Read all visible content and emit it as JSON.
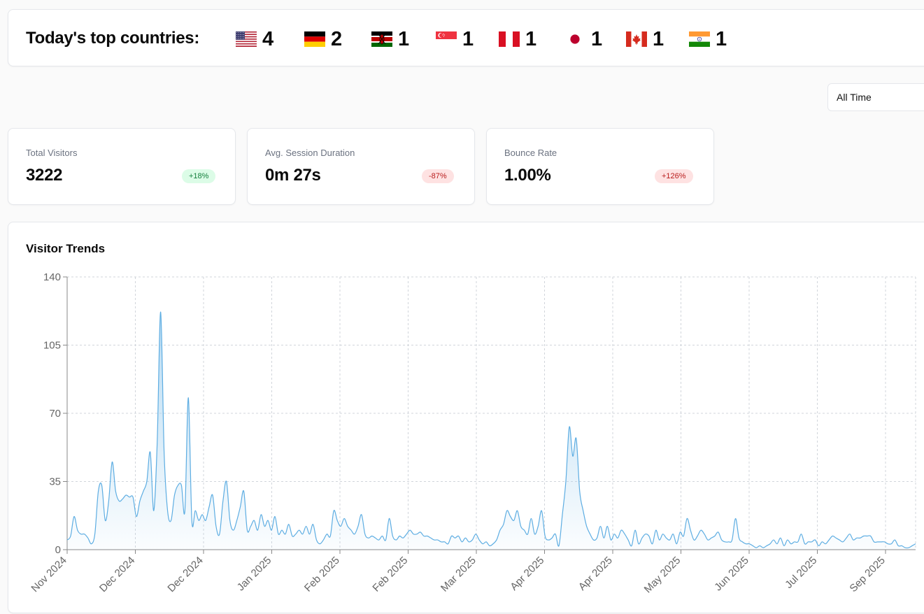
{
  "top_countries": {
    "title": "Today's top countries:",
    "items": [
      {
        "flag": "us-flag-icon",
        "count": "4"
      },
      {
        "flag": "germany-flag-icon",
        "count": "2"
      },
      {
        "flag": "kenya-flag-icon",
        "count": "1"
      },
      {
        "flag": "singapore-flag-icon",
        "count": "1"
      },
      {
        "flag": "peru-flag-icon",
        "count": "1"
      },
      {
        "flag": "japan-flag-icon",
        "count": "1"
      },
      {
        "flag": "canada-flag-icon",
        "count": "1"
      },
      {
        "flag": "india-flag-icon",
        "count": "1"
      }
    ]
  },
  "range_select": {
    "value": "All Time"
  },
  "stats": [
    {
      "label": "Total Visitors",
      "value": "3222",
      "change": "+18%",
      "trend": "up"
    },
    {
      "label": "Avg. Session Duration",
      "value": "0m 27s",
      "change": "-87%",
      "trend": "down"
    },
    {
      "label": "Bounce Rate",
      "value": "1.00%",
      "change": "+126%",
      "trend": "down"
    }
  ],
  "chart_card": {
    "title": "Visitor Trends"
  },
  "colors": {
    "line": "#5dade2",
    "fill": "#aed6f1",
    "grid": "#d1d5db",
    "up": "#15803d",
    "down": "#b91c1c"
  },
  "chart_data": {
    "type": "area",
    "title": "Visitor Trends",
    "ylim": [
      0,
      140
    ],
    "yticks": [
      0,
      35,
      70,
      105,
      140
    ],
    "grid": true,
    "xtick_labels": [
      "Nov 2024",
      "Dec 2024",
      "Dec 2024",
      "Jan 2025",
      "Feb 2025",
      "Feb 2025",
      "Mar 2025",
      "Apr 2025",
      "Apr 2025",
      "May 2025",
      "Jun 2025",
      "Jul 2025",
      "Sep 2025"
    ],
    "series": [
      {
        "values": [
          5,
          7,
          17,
          10,
          8,
          8,
          6,
          3,
          8,
          30,
          33,
          15,
          25,
          45,
          30,
          25,
          26,
          28,
          27,
          27,
          17,
          25,
          30,
          35,
          50,
          20,
          55,
          122,
          50,
          20,
          15,
          28,
          33,
          33,
          20,
          78,
          15,
          20,
          15,
          18,
          15,
          22,
          28,
          12,
          8,
          25,
          35,
          15,
          10,
          15,
          22,
          30,
          10,
          12,
          15,
          10,
          18,
          12,
          15,
          10,
          17,
          8,
          10,
          8,
          13,
          7,
          8,
          10,
          8,
          12,
          8,
          13,
          5,
          3,
          5,
          8,
          7,
          20,
          15,
          12,
          16,
          12,
          10,
          8,
          12,
          18,
          8,
          6,
          7,
          6,
          5,
          7,
          5,
          16,
          7,
          5,
          7,
          6,
          8,
          10,
          8,
          8,
          9,
          7,
          7,
          6,
          5,
          5,
          4,
          4,
          3,
          7,
          6,
          7,
          4,
          6,
          4,
          5,
          8,
          5,
          3,
          4,
          2,
          3,
          5,
          10,
          13,
          20,
          17,
          15,
          20,
          12,
          10,
          8,
          16,
          8,
          12,
          20,
          7,
          5,
          6,
          8,
          2,
          18,
          35,
          63,
          48,
          57,
          30,
          20,
          12,
          8,
          5,
          6,
          12,
          6,
          12,
          5,
          8,
          6,
          10,
          8,
          5,
          2,
          10,
          3,
          6,
          8,
          7,
          3,
          10,
          5,
          8,
          6,
          5,
          8,
          3,
          9,
          7,
          16,
          10,
          5,
          7,
          10,
          8,
          5,
          6,
          7,
          9,
          5,
          4,
          4,
          5,
          16,
          6,
          4,
          3,
          3,
          2,
          1,
          2,
          1,
          2,
          3,
          5,
          3,
          6,
          2,
          5,
          3,
          4,
          4,
          8,
          3,
          4,
          4,
          5,
          2,
          4,
          3,
          5,
          7,
          6,
          5,
          4,
          6,
          8,
          5,
          6,
          6,
          7,
          7,
          7,
          4,
          4,
          4,
          4,
          3,
          3,
          5,
          2,
          2,
          1,
          1,
          2,
          3
        ]
      }
    ]
  }
}
